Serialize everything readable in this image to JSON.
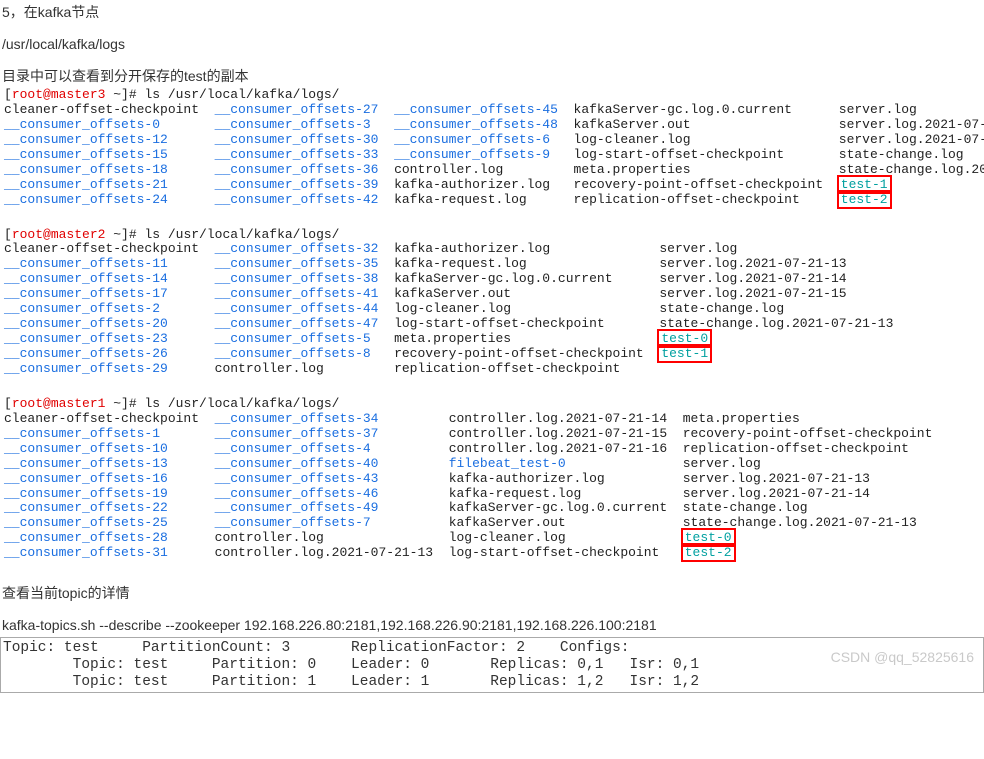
{
  "text": {
    "line1": "5，在kafka节点",
    "line2": "/usr/local/kafka/logs",
    "line3": "目录中可以查看到分开保存的test的副本",
    "line4": "查看当前topic的详情",
    "line5": "kafka-topics.sh --describe --zookeeper 192.168.226.80:2181,192.168.226.90:2181,192.168.226.100:2181"
  },
  "prompt3": "[root@master3 ~]# ls /usr/local/kafka/logs/",
  "m3": {
    "r1": [
      "cleaner-offset-checkpoint",
      "__consumer_offsets-27",
      "__consumer_offsets-45",
      "kafkaServer-gc.log.0.current",
      "server.log"
    ],
    "r2": [
      "__consumer_offsets-0",
      "__consumer_offsets-3",
      "__consumer_offsets-48",
      "kafkaServer.out",
      "server.log.2021-07-"
    ],
    "r3": [
      "__consumer_offsets-12",
      "__consumer_offsets-30",
      "__consumer_offsets-6",
      "log-cleaner.log",
      "server.log.2021-07-"
    ],
    "r4": [
      "__consumer_offsets-15",
      "__consumer_offsets-33",
      "__consumer_offsets-9",
      "log-start-offset-checkpoint",
      "state-change.log"
    ],
    "r5": [
      "__consumer_offsets-18",
      "__consumer_offsets-36",
      "controller.log",
      "meta.properties",
      "state-change.log.20"
    ],
    "r6": [
      "__consumer_offsets-21",
      "__consumer_offsets-39",
      "kafka-authorizer.log",
      "recovery-point-offset-checkpoint",
      "test-1"
    ],
    "r7": [
      "__consumer_offsets-24",
      "__consumer_offsets-42",
      "kafka-request.log",
      "replication-offset-checkpoint",
      "test-2"
    ]
  },
  "prompt2": "[root@master2 ~]# ls /usr/local/kafka/logs/",
  "m2": {
    "r1": [
      "cleaner-offset-checkpoint",
      "__consumer_offsets-32",
      "kafka-authorizer.log",
      "server.log"
    ],
    "r2": [
      "__consumer_offsets-11",
      "__consumer_offsets-35",
      "kafka-request.log",
      "server.log.2021-07-21-13"
    ],
    "r3": [
      "__consumer_offsets-14",
      "__consumer_offsets-38",
      "kafkaServer-gc.log.0.current",
      "server.log.2021-07-21-14"
    ],
    "r4": [
      "__consumer_offsets-17",
      "__consumer_offsets-41",
      "kafkaServer.out",
      "server.log.2021-07-21-15"
    ],
    "r5": [
      "__consumer_offsets-2",
      "__consumer_offsets-44",
      "log-cleaner.log",
      "state-change.log"
    ],
    "r6": [
      "__consumer_offsets-20",
      "__consumer_offsets-47",
      "log-start-offset-checkpoint",
      "state-change.log.2021-07-21-13"
    ],
    "r7": [
      "__consumer_offsets-23",
      "__consumer_offsets-5",
      "meta.properties",
      "test-0"
    ],
    "r8": [
      "__consumer_offsets-26",
      "__consumer_offsets-8",
      "recovery-point-offset-checkpoint",
      "test-1"
    ],
    "r9": [
      "__consumer_offsets-29",
      "controller.log",
      "replication-offset-checkpoint",
      ""
    ]
  },
  "prompt1": "[root@master1 ~]# ls /usr/local/kafka/logs/",
  "m1": {
    "r1": [
      "cleaner-offset-checkpoint",
      "__consumer_offsets-34",
      "controller.log.2021-07-21-14",
      "meta.properties"
    ],
    "r2": [
      "__consumer_offsets-1",
      "__consumer_offsets-37",
      "controller.log.2021-07-21-15",
      "recovery-point-offset-checkpoint"
    ],
    "r3": [
      "__consumer_offsets-10",
      "__consumer_offsets-4",
      "controller.log.2021-07-21-16",
      "replication-offset-checkpoint"
    ],
    "r4": [
      "__consumer_offsets-13",
      "__consumer_offsets-40",
      "filebeat_test-0",
      "server.log"
    ],
    "r5": [
      "__consumer_offsets-16",
      "__consumer_offsets-43",
      "kafka-authorizer.log",
      "server.log.2021-07-21-13"
    ],
    "r6": [
      "__consumer_offsets-19",
      "__consumer_offsets-46",
      "kafka-request.log",
      "server.log.2021-07-21-14"
    ],
    "r7": [
      "__consumer_offsets-22",
      "__consumer_offsets-49",
      "kafkaServer-gc.log.0.current",
      "state-change.log"
    ],
    "r8": [
      "__consumer_offsets-25",
      "__consumer_offsets-7",
      "kafkaServer.out",
      "state-change.log.2021-07-21-13"
    ],
    "r9": [
      "__consumer_offsets-28",
      "controller.log",
      "log-cleaner.log",
      "test-0"
    ],
    "r10": [
      "__consumer_offsets-31",
      "controller.log.2021-07-21-13",
      "log-start-offset-checkpoint",
      "test-2"
    ]
  },
  "topic": {
    "header": "Topic: test     PartitionCount: 3       ReplicationFactor: 2    Configs:",
    "row0": "        Topic: test     Partition: 0    Leader: 0       Replicas: 0,1   Isr: 0,1",
    "row1": "        Topic: test     Partition: 1    Leader: 1       Replicas: 1,2   Isr: 1,2"
  },
  "watermark": "CSDN @qq_52825616"
}
